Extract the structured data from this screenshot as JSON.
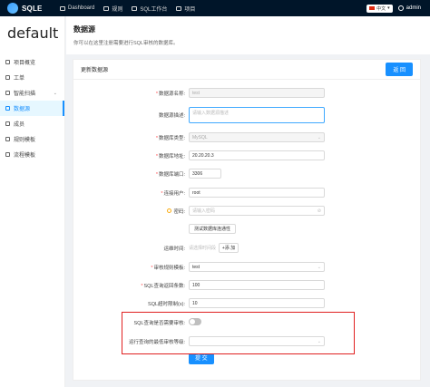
{
  "topbar": {
    "logo": "SQLE",
    "nav": [
      {
        "label": "Dashboard",
        "icon": "dashboard-icon"
      },
      {
        "label": "规则",
        "icon": "rule-icon"
      },
      {
        "label": "SQL工作台",
        "icon": "sql-workbench-icon"
      },
      {
        "label": "项目",
        "icon": "project-icon"
      }
    ],
    "lang": "中文",
    "user": "admin"
  },
  "sidebar": {
    "project_name": "default",
    "items": [
      {
        "label": "项目概览"
      },
      {
        "label": "工单"
      },
      {
        "label": "智能扫描"
      },
      {
        "label": "数据源"
      },
      {
        "label": "成员"
      },
      {
        "label": "规则模板"
      },
      {
        "label": "流程模板"
      }
    ]
  },
  "header": {
    "title": "数据源",
    "desc": "你可以在这里注册需要进行SQL审核的数据库。"
  },
  "card": {
    "title": "更新数据源",
    "back_label": "返 回"
  },
  "form": {
    "name_label": "数据源名称:",
    "name_value": "test",
    "desc_label": "数据源描述:",
    "desc_placeholder": "请输入数据源描述",
    "type_label": "数据库类型:",
    "type_value": "MySQL",
    "host_label": "数据库地址:",
    "host_value": "20.20.20.3",
    "port_label": "数据库端口:",
    "port_value": "3306",
    "user_label": "连接用户:",
    "user_value": "root",
    "password_label": "密码:",
    "password_placeholder": "请输入密码",
    "test_conn_label": "测试数据库连通性",
    "maintain_label": "运维时间:",
    "maintain_placeholder": "请选择时间段",
    "maintain_add": "添 加",
    "rule_tpl_label": "审核规则模板:",
    "rule_tpl_value": "test",
    "sql_query_rows_label": "SQL查询返回条数:",
    "sql_query_rows_value": "100",
    "sql_timeout_label": "SQL超时限制(s):",
    "sql_timeout_value": "10",
    "need_audit_label": "SQL查询是否需要审核:",
    "min_level_label": "运行查询的最低审核等级:",
    "submit_label": "提 交"
  }
}
